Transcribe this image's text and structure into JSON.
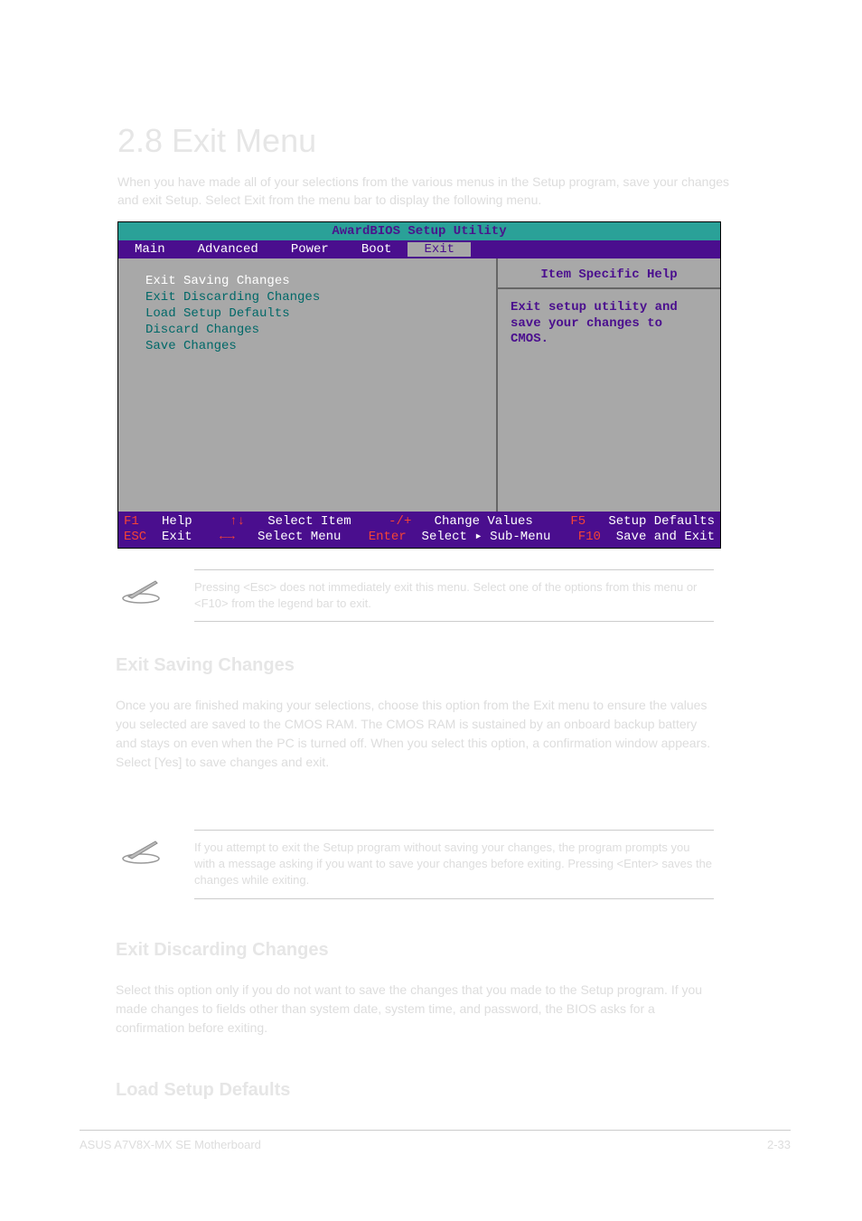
{
  "page_heading": "2.8 Exit Menu",
  "page_intro": "When you have made all of your selections from the various menus in the Setup program, save your changes and exit Setup. Select Exit from the menu bar to display the following menu.",
  "bios": {
    "title": "AwardBIOS Setup Utility",
    "menu": [
      "Main",
      "Advanced",
      "Power",
      "Boot",
      "Exit"
    ],
    "active_menu": "Exit",
    "options": [
      "Exit Saving Changes",
      "Exit Discarding Changes",
      "Load Setup Defaults",
      "Discard Changes",
      "Save Changes"
    ],
    "selected_option": "Exit Saving Changes",
    "help_title": "Item Specific Help",
    "help_text": "Exit setup utility and save your changes to CMOS.",
    "footer_line1": {
      "k1": "F1",
      "l1": "Help",
      "k2": "↑↓",
      "l2": "Select Item",
      "k3": "-/+",
      "l3": "Change Values",
      "k4": "F5",
      "l4": "Setup Defaults"
    },
    "footer_line2": {
      "k1": "ESC",
      "l1": "Exit",
      "k2": "←→",
      "l2": "Select Menu",
      "k3": "Enter",
      "l3": "Select ▸ Sub-Menu",
      "k4": "F10",
      "l4": "Save and Exit"
    }
  },
  "note1": "Pressing <Esc> does not immediately exit this menu. Select one of the options from this menu or <F10> from the legend bar to exit.",
  "section1_title": "Exit Saving Changes",
  "body1": "Once you are finished making your selections, choose this option from the Exit menu to ensure the values you selected are saved to the CMOS RAM. The CMOS RAM is sustained by an onboard backup battery and stays on even when the PC is turned off. When you select this option, a confirmation window appears. Select [Yes] to save changes and exit.",
  "note2": "If you attempt to exit the Setup program without saving your changes, the program prompts you with a message asking if you want to save your changes before exiting. Pressing <Enter> saves the changes while exiting.",
  "section2_title": "Exit Discarding Changes",
  "body2": "Select this option only if you do not want to save the changes that you made to the Setup program. If you made changes to fields other than system date, system time, and password, the BIOS asks for a confirmation before exiting.",
  "section3_title": "Load Setup Defaults",
  "footer_left": "ASUS A7V8X-MX SE Motherboard",
  "footer_right": "2-33"
}
